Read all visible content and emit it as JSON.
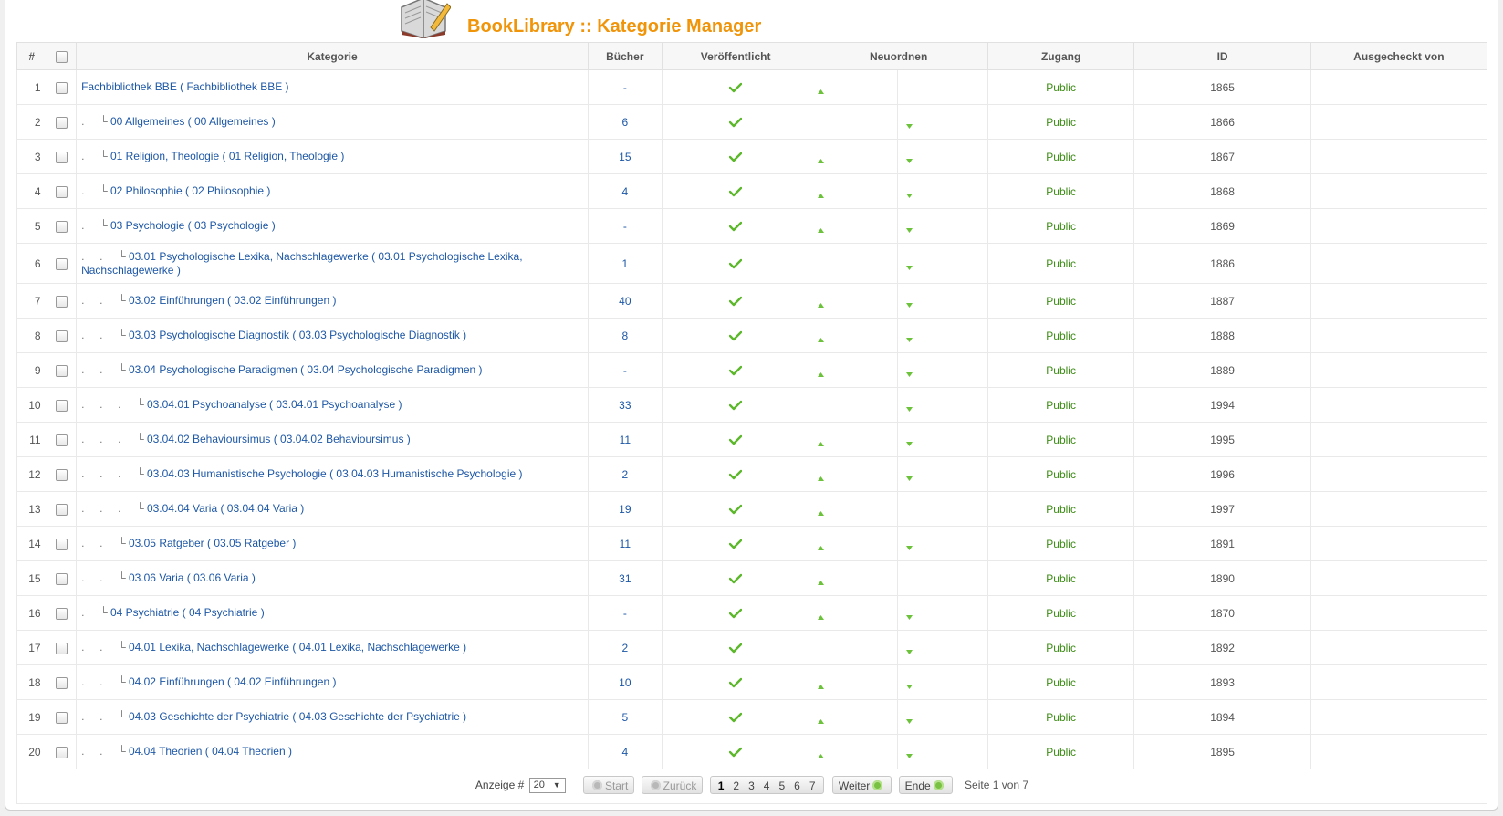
{
  "header": {
    "title": "BookLibrary :: Kategorie Manager"
  },
  "columns": {
    "num": "#",
    "kategorie": "Kategorie",
    "buecher": "Bücher",
    "veroeffentlicht": "Veröffentlicht",
    "neuordnen": "Neuordnen",
    "zugang": "Zugang",
    "id": "ID",
    "ausgecheckt": "Ausgecheckt von"
  },
  "rows": [
    {
      "num": "1",
      "level": 0,
      "name": "Fachbibliothek BBE ( Fachbibliothek BBE )",
      "books": "-",
      "up": true,
      "down": false,
      "access": "Public",
      "id": "1865"
    },
    {
      "num": "2",
      "level": 1,
      "name": "00 Allgemeines ( 00 Allgemeines )",
      "books": "6",
      "up": false,
      "down": true,
      "access": "Public",
      "id": "1866"
    },
    {
      "num": "3",
      "level": 1,
      "name": "01 Religion, Theologie ( 01 Religion, Theologie )",
      "books": "15",
      "up": true,
      "down": true,
      "access": "Public",
      "id": "1867"
    },
    {
      "num": "4",
      "level": 1,
      "name": "02 Philosophie ( 02 Philosophie )",
      "books": "4",
      "up": true,
      "down": true,
      "access": "Public",
      "id": "1868"
    },
    {
      "num": "5",
      "level": 1,
      "name": "03 Psychologie ( 03 Psychologie )",
      "books": "-",
      "up": true,
      "down": true,
      "access": "Public",
      "id": "1869"
    },
    {
      "num": "6",
      "level": 2,
      "name": "03.01 Psychologische Lexika, Nachschlagewerke ( 03.01 Psychologische Lexika, Nachschlagewerke )",
      "books": "1",
      "up": false,
      "down": true,
      "access": "Public",
      "id": "1886"
    },
    {
      "num": "7",
      "level": 2,
      "name": "03.02 Einführungen ( 03.02 Einführungen )",
      "books": "40",
      "up": true,
      "down": true,
      "access": "Public",
      "id": "1887"
    },
    {
      "num": "8",
      "level": 2,
      "name": "03.03 Psychologische Diagnostik ( 03.03 Psychologische Diagnostik )",
      "books": "8",
      "up": true,
      "down": true,
      "access": "Public",
      "id": "1888"
    },
    {
      "num": "9",
      "level": 2,
      "name": "03.04 Psychologische Paradigmen ( 03.04 Psychologische Paradigmen )",
      "books": "-",
      "up": true,
      "down": true,
      "access": "Public",
      "id": "1889"
    },
    {
      "num": "10",
      "level": 3,
      "name": "03.04.01 Psychoanalyse ( 03.04.01 Psychoanalyse )",
      "books": "33",
      "up": false,
      "down": true,
      "access": "Public",
      "id": "1994"
    },
    {
      "num": "11",
      "level": 3,
      "name": "03.04.02 Behavioursimus ( 03.04.02 Behavioursimus )",
      "books": "11",
      "up": true,
      "down": true,
      "access": "Public",
      "id": "1995"
    },
    {
      "num": "12",
      "level": 3,
      "name": "03.04.03 Humanistische Psychologie ( 03.04.03 Humanistische Psychologie )",
      "books": "2",
      "up": true,
      "down": true,
      "access": "Public",
      "id": "1996"
    },
    {
      "num": "13",
      "level": 3,
      "name": "03.04.04 Varia ( 03.04.04 Varia )",
      "books": "19",
      "up": true,
      "down": false,
      "access": "Public",
      "id": "1997"
    },
    {
      "num": "14",
      "level": 2,
      "name": "03.05 Ratgeber ( 03.05 Ratgeber )",
      "books": "11",
      "up": true,
      "down": true,
      "access": "Public",
      "id": "1891"
    },
    {
      "num": "15",
      "level": 2,
      "name": "03.06 Varia ( 03.06 Varia )",
      "books": "31",
      "up": true,
      "down": false,
      "access": "Public",
      "id": "1890"
    },
    {
      "num": "16",
      "level": 1,
      "name": "04 Psychiatrie ( 04 Psychiatrie )",
      "books": "-",
      "up": true,
      "down": true,
      "access": "Public",
      "id": "1870"
    },
    {
      "num": "17",
      "level": 2,
      "name": "04.01 Lexika, Nachschlagewerke ( 04.01 Lexika, Nachschlagewerke )",
      "books": "2",
      "up": false,
      "down": true,
      "access": "Public",
      "id": "1892"
    },
    {
      "num": "18",
      "level": 2,
      "name": "04.02 Einführungen ( 04.02 Einführungen )",
      "books": "10",
      "up": true,
      "down": true,
      "access": "Public",
      "id": "1893"
    },
    {
      "num": "19",
      "level": 2,
      "name": "04.03 Geschichte der Psychiatrie ( 04.03 Geschichte der Psychiatrie )",
      "books": "5",
      "up": true,
      "down": true,
      "access": "Public",
      "id": "1894"
    },
    {
      "num": "20",
      "level": 2,
      "name": "04.04 Theorien ( 04.04 Theorien )",
      "books": "4",
      "up": true,
      "down": true,
      "access": "Public",
      "id": "1895"
    }
  ],
  "pagination": {
    "limit_label": "Anzeige #",
    "limit_value": "20",
    "start": "Start",
    "prev": "Zurück",
    "pages": [
      "1",
      "2",
      "3",
      "4",
      "5",
      "6",
      "7"
    ],
    "current_page": "1",
    "next": "Weiter",
    "end": "Ende",
    "counter": "Seite 1 von 7"
  },
  "colors": {
    "title": "#f0950a",
    "link": "#1e58a6",
    "public": "#3c8c14",
    "check": "#5cb82a",
    "arrow": "#6cc23a"
  },
  "icons": {
    "logo": "book-library-logo-icon",
    "published": "check-icon",
    "order_up": "arrow-up-icon",
    "order_down": "arrow-down-icon"
  }
}
